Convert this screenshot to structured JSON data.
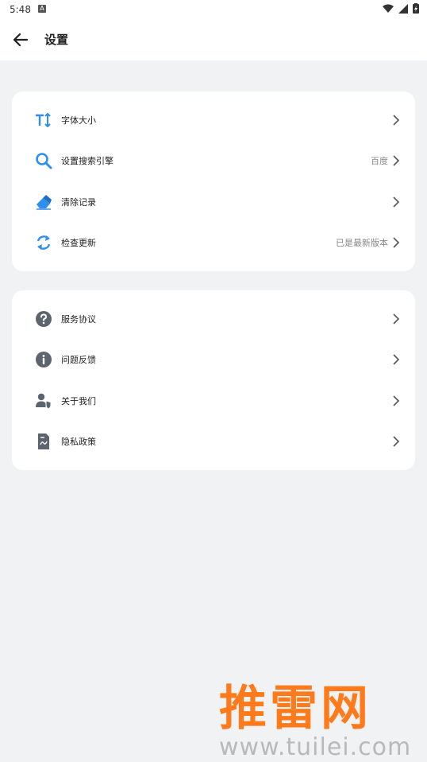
{
  "status": {
    "time": "5:48",
    "a_icon": "A"
  },
  "appbar": {
    "title": "设置"
  },
  "group1": [
    {
      "name": "font-size-row",
      "label": "字体大小",
      "value": "",
      "icon": "text-size-icon"
    },
    {
      "name": "search-engine-row",
      "label": "设置搜索引擎",
      "value": "百度",
      "icon": "search-icon"
    },
    {
      "name": "clear-history-row",
      "label": "清除记录",
      "value": "",
      "icon": "eraser-icon"
    },
    {
      "name": "check-update-row",
      "label": "检查更新",
      "value": "已是最新版本",
      "icon": "refresh-icon"
    }
  ],
  "group2": [
    {
      "name": "service-agreement-row",
      "label": "服务协议",
      "value": "",
      "icon": "help-icon"
    },
    {
      "name": "feedback-row",
      "label": "问题反馈",
      "value": "",
      "icon": "info-icon"
    },
    {
      "name": "about-us-row",
      "label": "关于我们",
      "value": "",
      "icon": "user-shield-icon"
    },
    {
      "name": "privacy-policy-row",
      "label": "隐私政策",
      "value": "",
      "icon": "document-icon"
    }
  ],
  "watermark": {
    "brand": "推雷网",
    "url": "www.tuilei.com"
  },
  "colors": {
    "blue": "#2f8ff0",
    "gray_icon": "#5d6470",
    "watermark": "#ff7a1a"
  }
}
